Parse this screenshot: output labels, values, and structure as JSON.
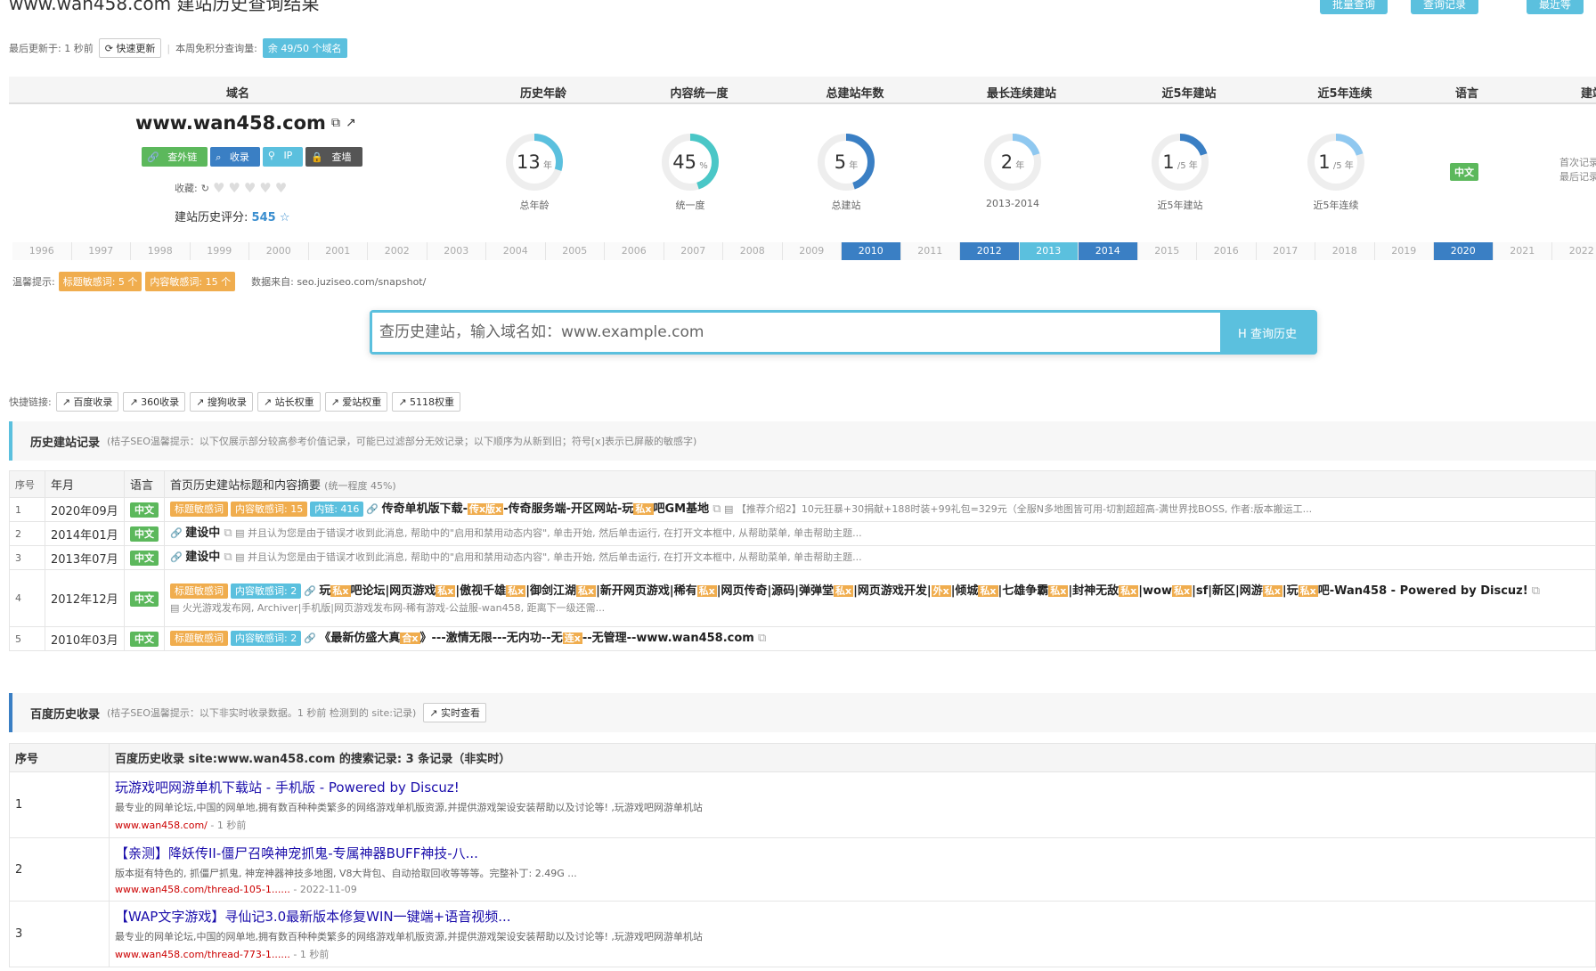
{
  "title": "www.wan458.com 建站历史查询结果",
  "top_buttons": [
    "批量查询",
    "查询记录",
    "最近等"
  ],
  "meta": {
    "updated_label": "最后更新于: 1 秒前",
    "refresh_btn": "快速更新",
    "quota_label": "本周免积分查询量:",
    "quota_badge": "余 49/50 个域名"
  },
  "columns": [
    "域名",
    "历史年龄",
    "内容统一度",
    "总建站年数",
    "最长连续建站",
    "近5年建站",
    "近5年连续",
    "语言",
    "建站"
  ],
  "domain": "www.wan458.com",
  "tools": [
    "查外链",
    "收录",
    "IP",
    "查墙"
  ],
  "fav_label": "收藏:",
  "score_label": "建站历史评分:",
  "score": "545",
  "stats": [
    {
      "value": "13",
      "unit": "年",
      "label": "总年龄",
      "fraction": 0.3,
      "color": "#5bc0de"
    },
    {
      "value": "45",
      "unit": "%",
      "label": "统一度",
      "fraction": 0.45,
      "color": "#4ac7c7"
    },
    {
      "value": "5",
      "unit": "年",
      "label": "总建站",
      "fraction": 0.45,
      "color": "#3a7fc4"
    },
    {
      "value": "2",
      "unit": "年",
      "label": "2013-2014",
      "fraction": 0.2,
      "color": "#8fc8f0"
    },
    {
      "value": "1",
      "unit": "/5 年",
      "label": "近5年建站",
      "fraction": 0.2,
      "color": "#3a7fc4"
    },
    {
      "value": "1",
      "unit": "/5 年",
      "label": "近5年连续",
      "fraction": 0.2,
      "color": "#8fc8f0"
    }
  ],
  "language": "中文",
  "first_record": [
    "首次记录",
    "最后记录"
  ],
  "timeline": [
    {
      "y": "1996",
      "s": 0
    },
    {
      "y": "1997",
      "s": 0
    },
    {
      "y": "1998",
      "s": 0
    },
    {
      "y": "1999",
      "s": 0
    },
    {
      "y": "2000",
      "s": 0
    },
    {
      "y": "2001",
      "s": 0
    },
    {
      "y": "2002",
      "s": 0
    },
    {
      "y": "2003",
      "s": 0
    },
    {
      "y": "2004",
      "s": 0
    },
    {
      "y": "2005",
      "s": 0
    },
    {
      "y": "2006",
      "s": 0
    },
    {
      "y": "2007",
      "s": 0
    },
    {
      "y": "2008",
      "s": 0
    },
    {
      "y": "2009",
      "s": 0
    },
    {
      "y": "2010",
      "s": 1
    },
    {
      "y": "2011",
      "s": 0
    },
    {
      "y": "2012",
      "s": 1
    },
    {
      "y": "2013",
      "s": 2
    },
    {
      "y": "2014",
      "s": 1
    },
    {
      "y": "2015",
      "s": 0
    },
    {
      "y": "2016",
      "s": 0
    },
    {
      "y": "2017",
      "s": 0
    },
    {
      "y": "2018",
      "s": 0
    },
    {
      "y": "2019",
      "s": 0
    },
    {
      "y": "2020",
      "s": 1
    },
    {
      "y": "2021",
      "s": 0
    },
    {
      "y": "2022",
      "s": 0
    }
  ],
  "tips": {
    "label": "温馨提示:",
    "b1": "标题敏感词: 5 个",
    "b2": "内容敏感词: 15 个",
    "source": "数据来自: seo.juziseo.com/snapshot/"
  },
  "search": {
    "placeholder": "查历史建站，输入域名如：www.example.com",
    "button": "H 查询历史"
  },
  "quick": {
    "label": "快捷链接:",
    "links": [
      "百度收录",
      "360收录",
      "搜狗收录",
      "站长权重",
      "爱站权重",
      "5118权重"
    ]
  },
  "history": {
    "title": "历史建站记录",
    "note": "(桔子SEO温馨提示：以下仅展示部分较高参考价值记录，可能已过滤部分无效记录；以下顺序为从新到旧；符号[x]表示已屏蔽的敏感字)",
    "headers": [
      "序号",
      "年月",
      "语言",
      "首页历史建站标题和内容摘要",
      "(统一程度 45%)"
    ],
    "rows": [
      {
        "no": "1",
        "date": "2020年09月",
        "lang": "中文",
        "tags": [
          "标题敏感词",
          "内容敏感词: 15",
          "内链: 416"
        ],
        "title": "传奇单机版下载-[传x版x]-传奇服务端-开区网站-玩[私x]吧GM基地",
        "sub": "【推荐介绍2】10元狂暴+30捐献+188时装+99礼包=329元（全服N多地图皆可用-切割超超高-满世界找BOSS, 作者:版本搬运工..."
      },
      {
        "no": "2",
        "date": "2014年01月",
        "lang": "中文",
        "tags": [],
        "title": "建设中",
        "sub": "并且认为您是由于错误才收到此消息, 帮助中的\"启用和禁用动态内容\", 单击开始, 然后单击运行, 在打开文本框中, 从帮助菜单, 单击帮助主题..."
      },
      {
        "no": "3",
        "date": "2013年07月",
        "lang": "中文",
        "tags": [],
        "title": "建设中",
        "sub": "并且认为您是由于错误才收到此消息, 帮助中的\"启用和禁用动态内容\", 单击开始, 然后单击运行, 在打开文本框中, 从帮助菜单, 单击帮助主题..."
      },
      {
        "no": "4",
        "date": "2012年12月",
        "lang": "中文",
        "tags": [
          "标题敏感词",
          "内容敏感词: 2"
        ],
        "title": "玩[私x]吧论坛|网页游戏[私x]|傲视千雄[私x]|御剑江湖[私x]|新开网页游戏|稀有[私x]|网页传奇|源码|弹弹堂[私x]|网页游戏开发|[外x]|倾城[私x]|七雄争霸[私x]|封神无敌[私x]|wow[私x]|sf|新区|网游[私x]|玩[私x]吧-Wan458 - Powered by Discuz!",
        "sub": "火光游戏发布网, Archiver|手机版|网页游戏发布网-稀有游戏-公益服-wan458, 距离下一级还需..."
      },
      {
        "no": "5",
        "date": "2010年03月",
        "lang": "中文",
        "tags": [
          "标题敏感词",
          "内容敏感词: 2"
        ],
        "title": "《最新仿盛大真[合x]》---激情无限---无内功--无[连x]--无管理--www.wan458.com",
        "sub": ""
      }
    ]
  },
  "baidu": {
    "title": "百度历史收录",
    "note": "(桔子SEO温馨提示：以下非实时收录数据。1 秒前 检测到的 site:记录)",
    "live_btn": "实时查看",
    "headers": [
      "序号",
      "百度历史收录 site:www.wan458.com 的搜索记录: 3 条记录（非实时）"
    ],
    "rows": [
      {
        "no": "1",
        "title": "玩游戏吧网游单机下载站 - 手机版 - Powered by Discuz!",
        "desc": "最专业的网单论坛,中国的网单地,拥有数百种种类繁多的网络游戏单机版资源,并提供游戏架设安装帮助以及讨论等! ,玩游戏吧网游单机站",
        "url": "www.wan458.com/",
        "time": " - 1 秒前"
      },
      {
        "no": "2",
        "title": "【亲测】降妖传II-僵尸召唤神宠抓鬼-专属神器BUFF神技-八...",
        "desc": "版本挺有特色的, 抓僵尸抓鬼, 神宠神器神技多地图, V8大背包、自动拾取回收等等等。完整补丁: 2.49G ...",
        "url": "www.wan458.com/thread-105-1......",
        "time": " - 2022-11-09"
      },
      {
        "no": "3",
        "title": "【WAP文字游戏】寻仙记3.0最新版本修复WIN一键端+语音视频...",
        "desc": "最专业的网单论坛,中国的网单地,拥有数百种种类繁多的网络游戏单机版资源,并提供游戏架设安装帮助以及讨论等! ,玩游戏吧网游单机站",
        "url": "www.wan458.com/thread-773-1......",
        "time": " - 1 秒前"
      }
    ]
  }
}
